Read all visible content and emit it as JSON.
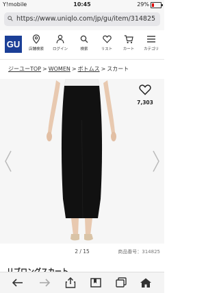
{
  "status_bar": {
    "carrier": "Y!mobile",
    "time": "10:45",
    "battery": "29%"
  },
  "browser": {
    "url": "https://www.uniqlo.com/jp/gu/item/314825"
  },
  "header": {
    "logo": "GU",
    "nav": [
      {
        "label": "店舗検索",
        "icon": "location-pin-icon"
      },
      {
        "label": "ログイン",
        "icon": "person-icon"
      },
      {
        "label": "検索",
        "icon": "search-icon"
      },
      {
        "label": "リスト",
        "icon": "heart-icon"
      },
      {
        "label": "カート",
        "icon": "cart-icon"
      },
      {
        "label": "カテゴリ",
        "icon": "menu-icon"
      }
    ]
  },
  "breadcrumb": {
    "items": [
      "ジーユーTOP",
      "WOMEN",
      "ボトムス"
    ],
    "separator": ">",
    "current": "スカート"
  },
  "product": {
    "favorite_count": "7,303",
    "pager": "2 / 15",
    "product_number": "商品番号：314825",
    "title_peek": "リブロングスカート"
  },
  "colors": {
    "brand": "#1b3f97",
    "skirt": "#111111",
    "skin": "#e8c9b0",
    "top": "#f2f2f2"
  },
  "toolbar": {
    "icons": [
      "back-arrow-icon",
      "forward-arrow-icon",
      "share-icon",
      "bookmarks-icon",
      "tabs-icon",
      "home-icon"
    ]
  }
}
